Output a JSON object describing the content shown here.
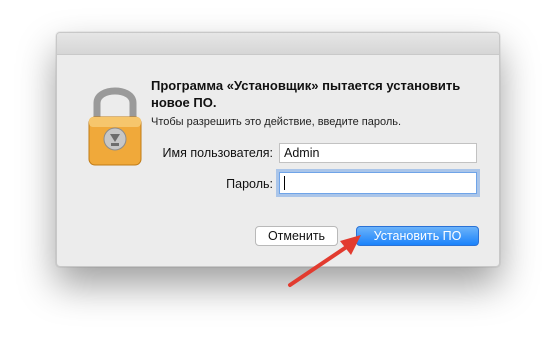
{
  "dialog": {
    "heading": "Программа «Установщик» пытается установить новое ПО.",
    "subtext": "Чтобы разрешить это действие, введите пароль.",
    "username_label": "Имя пользователя:",
    "username_value": "Admin",
    "password_label": "Пароль:",
    "password_value": "",
    "cancel_label": "Отменить",
    "install_label": "Установить ПО",
    "icon": "lock-icon"
  },
  "colors": {
    "accent": "#1a82fb",
    "annotation_arrow": "#e23b2f"
  }
}
